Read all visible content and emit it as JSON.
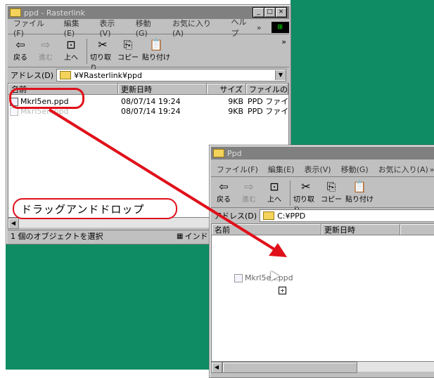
{
  "colors": {
    "desktop": "#0f8c63",
    "highlight": "#e0101a",
    "window_face": "#c0c0c0",
    "title_inactive": "#808080"
  },
  "win1": {
    "title": "ppd - Rasterlink",
    "controls": [
      "_",
      "□",
      "×"
    ],
    "menu": [
      "ファイル(F)",
      "編集(E)",
      "表示(V)",
      "移動(G)",
      "お気に入り(A)",
      "ヘルプ"
    ],
    "menu_more": "»",
    "toolbar": [
      {
        "icon": "⇦",
        "label": "戻る",
        "enabled": true
      },
      {
        "icon": "⇨",
        "label": "進む",
        "enabled": false
      },
      {
        "icon": "⊡",
        "label": "上へ",
        "enabled": true
      },
      {
        "icon": "✂",
        "label": "切り取り",
        "enabled": true
      },
      {
        "icon": "⎘",
        "label": "コピー",
        "enabled": true
      },
      {
        "icon": "📋",
        "label": "貼り付け",
        "enabled": true
      }
    ],
    "toolbar_more": "»",
    "address_label": "アドレス(D)",
    "address_value": "¥¥Rasterlink¥ppd",
    "columns": [
      "名前",
      "更新日時",
      "サイズ",
      "ファイルの種"
    ],
    "rows": [
      {
        "name": "Mkrl5en.ppd",
        "date": "08/07/14 19:24",
        "size": "9KB",
        "type": "PPD ファイ"
      },
      {
        "name": "Mkrl5en.ppd",
        "date": "08/07/14 19:24",
        "size": "9KB",
        "type": "PPD ファイ"
      }
    ],
    "status_left": "1 個のオブジェクトを選択",
    "status_right": "インド"
  },
  "win2": {
    "title": "Ppd",
    "menu": [
      "ファイル(F)",
      "編集(E)",
      "表示(V)",
      "移動(G)",
      "お気に入り(A)"
    ],
    "menu_more": "»",
    "toolbar": [
      {
        "icon": "⇦",
        "label": "戻る",
        "enabled": true
      },
      {
        "icon": "⇨",
        "label": "進む",
        "enabled": false
      },
      {
        "icon": "⊡",
        "label": "上へ",
        "enabled": true
      },
      {
        "icon": "✂",
        "label": "切り取り",
        "enabled": true
      },
      {
        "icon": "⎘",
        "label": "コピー",
        "enabled": true
      },
      {
        "icon": "📋",
        "label": "貼り付け",
        "enabled": true
      }
    ],
    "address_label": "アドレス(D)",
    "address_value": "C:¥PPD",
    "columns": [
      "名前",
      "更新日時"
    ],
    "dragged_file": "Mkrl5en.ppd",
    "drop_plus": "+"
  },
  "annotation": {
    "label": "ドラッグアンドドロップ"
  }
}
